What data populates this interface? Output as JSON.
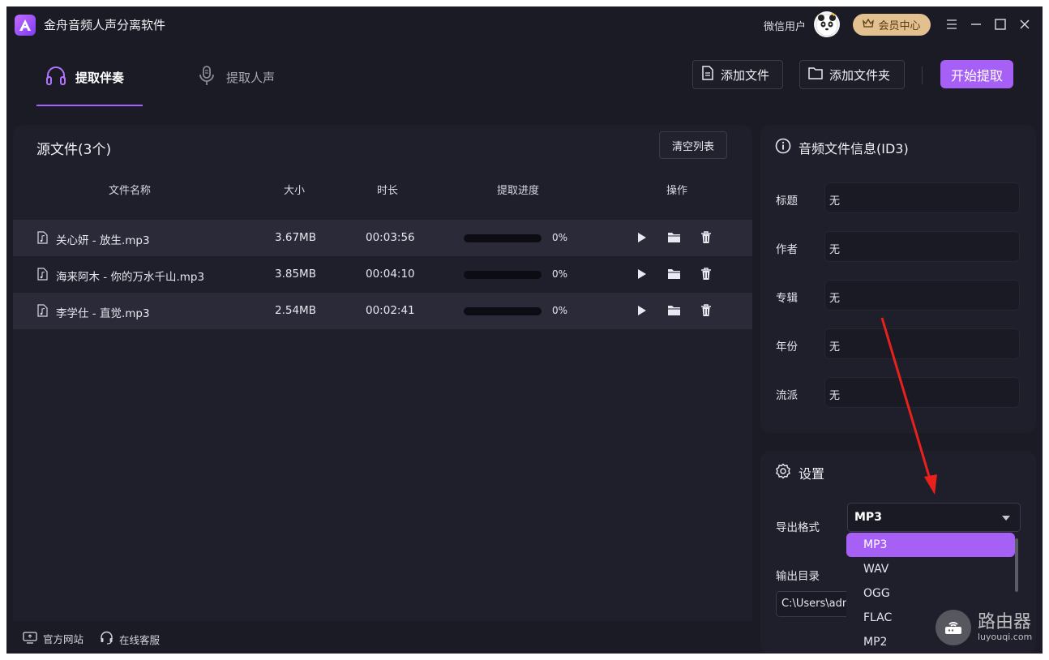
{
  "app": {
    "title": "金舟音频人声分离软件"
  },
  "user": {
    "name": "微信用户",
    "vip_label": "会员中心"
  },
  "tabs": [
    {
      "label": "提取伴奏",
      "active": true
    },
    {
      "label": "提取人声",
      "active": false
    }
  ],
  "toolbar": {
    "add_file": "添加文件",
    "add_folder": "添加文件夹",
    "start": "开始提取"
  },
  "source": {
    "title": "源文件(3个)",
    "clear_label": "清空列表",
    "headers": {
      "name": "文件名称",
      "size": "大小",
      "duration": "时长",
      "progress": "提取进度",
      "actions": "操作"
    },
    "files": [
      {
        "name": "关心妍 - 放生.mp3",
        "size": "3.67MB",
        "duration": "00:03:56",
        "progress": "0%",
        "progress_value": 0
      },
      {
        "name": "海来阿木 - 你的万水千山.mp3",
        "size": "3.85MB",
        "duration": "00:04:10",
        "progress": "0%",
        "progress_value": 0
      },
      {
        "name": "李学仕 - 直觉.mp3",
        "size": "2.54MB",
        "duration": "00:02:41",
        "progress": "0%",
        "progress_value": 0
      }
    ]
  },
  "id3": {
    "title": "音频文件信息(ID3)",
    "fields": [
      {
        "label": "标题",
        "value": "无"
      },
      {
        "label": "作者",
        "value": "无"
      },
      {
        "label": "专辑",
        "value": "无"
      },
      {
        "label": "年份",
        "value": "无"
      },
      {
        "label": "流派",
        "value": "无"
      }
    ]
  },
  "settings": {
    "title": "设置",
    "format_label": "导出格式",
    "format_value": "MP3",
    "output_label": "输出目录",
    "output_value": "C:\\Users\\adm",
    "format_options": [
      "MP3",
      "WAV",
      "OGG",
      "FLAC",
      "MP2"
    ]
  },
  "footer": {
    "website": "官方网站",
    "support": "在线客服"
  },
  "watermark": {
    "name": "路由器",
    "domain": "luyouqi.com"
  },
  "colors": {
    "accent": "#a660f5",
    "background": "#1b1b25",
    "panel": "#1f1f2b",
    "vip": "#e3c08f",
    "annotation_arrow": "#e8211c"
  }
}
